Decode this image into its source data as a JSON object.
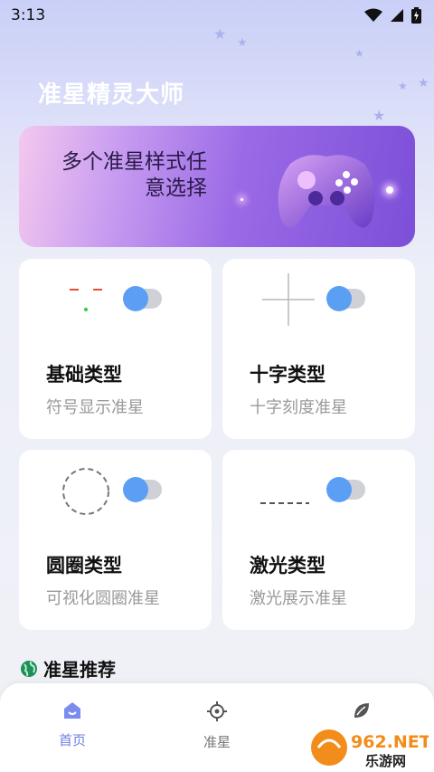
{
  "status": {
    "time": "3:13"
  },
  "app": {
    "title": "准星精灵大师"
  },
  "banner": {
    "line1": "多个准星样式任",
    "line2": "意选择"
  },
  "cards": [
    {
      "title": "基础类型",
      "subtitle": "符号显示准星",
      "enabled": true
    },
    {
      "title": "十字类型",
      "subtitle": "十字刻度准星",
      "enabled": true
    },
    {
      "title": "圆圈类型",
      "subtitle": "可视化圆圈准星",
      "enabled": true
    },
    {
      "title": "激光类型",
      "subtitle": "激光展示准星",
      "enabled": true
    }
  ],
  "section": {
    "title": "准星推荐",
    "icon": "globe-icon"
  },
  "tabs": [
    {
      "label": "首页",
      "icon": "home-icon",
      "active": true
    },
    {
      "label": "准星",
      "icon": "crosshair-icon",
      "active": false
    },
    {
      "label": "",
      "icon": "leaf-icon",
      "active": false
    }
  ],
  "watermark": {
    "brand": "962.NET",
    "text": "乐游网"
  },
  "colors": {
    "accent": "#5b9ff5",
    "tab_active": "#6c7fe6",
    "banner_purple": "#7c4fd8"
  }
}
